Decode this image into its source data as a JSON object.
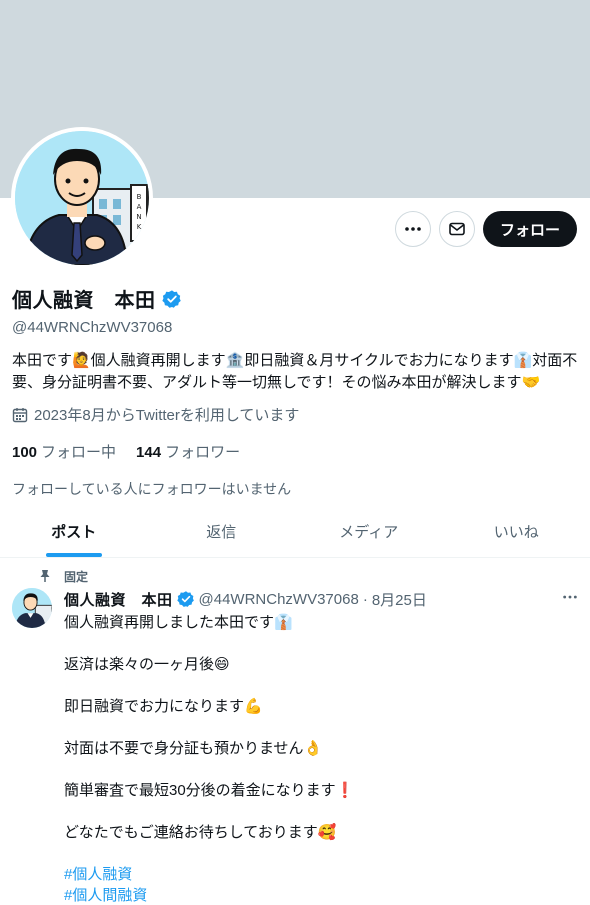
{
  "profile": {
    "display_name": "個人融資　本田",
    "handle": "@44WRNChzWV37068",
    "bio": "本田です🙋個人融資再開します🏦即日融資＆月サイクルでお力になります👔対面不要、身分証明書不要、アダルト等一切無しです！その悩み本田が解決します🤝",
    "joined": "2023年8月からTwitterを利用しています",
    "following_count": "100",
    "following_label": "フォロー中",
    "followers_count": "144",
    "followers_label": "フォロワー",
    "followed_by": "フォローしている人にフォロワーはいません"
  },
  "actions": {
    "more_icon": "more-icon",
    "message_icon": "mail-icon",
    "follow_label": "フォロー"
  },
  "tabs": [
    {
      "label": "ポスト",
      "active": true
    },
    {
      "label": "返信",
      "active": false
    },
    {
      "label": "メディア",
      "active": false
    },
    {
      "label": "いいね",
      "active": false
    }
  ],
  "tweet": {
    "pinned_label": "固定",
    "name": "個人融資　本田",
    "handle": "@44WRNChzWV37068",
    "sep": "·",
    "date": "8月25日",
    "lines": [
      "個人融資再開しました本田です👔",
      "",
      "返済は楽々の一ヶ月後😄",
      "",
      "即日融資でお力になります💪",
      "",
      "対面は不要で身分証も預かりません👌",
      "",
      "簡単審査で最短30分後の着金になります❗",
      "",
      "どなたでもご連絡お待ちしております🥰",
      ""
    ],
    "hashtags": [
      "#個人融資",
      "#個人間融資"
    ]
  },
  "colors": {
    "banner": "#cfd9de",
    "accent": "#1d9bf0",
    "text": "#0f1419",
    "muted": "#536471"
  }
}
